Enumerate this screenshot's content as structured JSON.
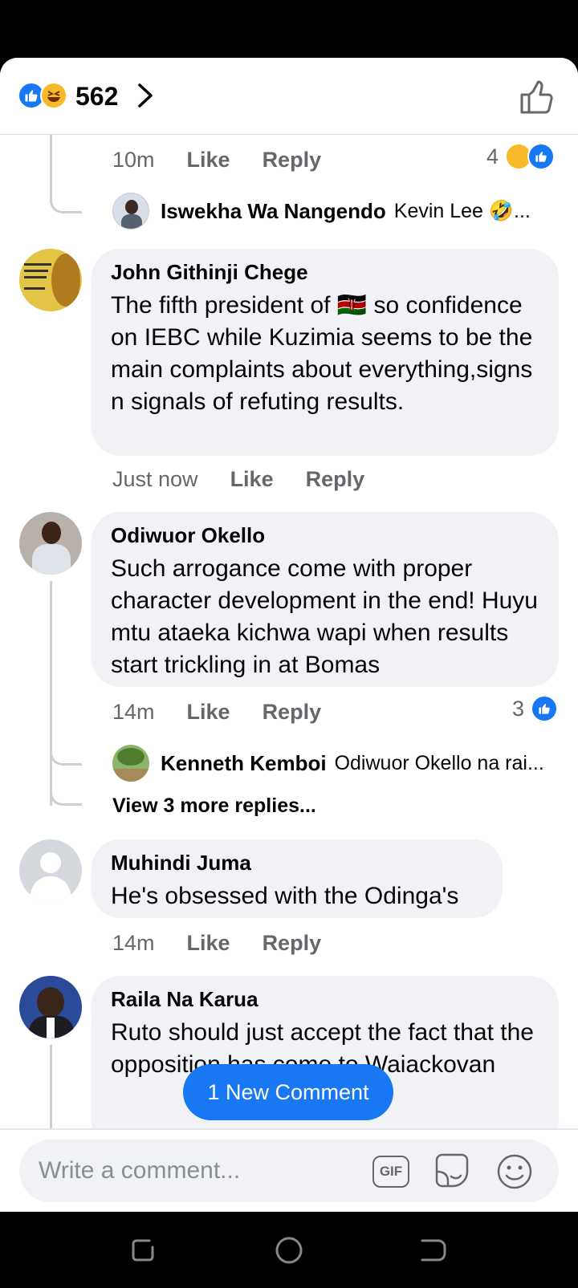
{
  "header": {
    "reaction_count": "562",
    "colors": {
      "like": "#1877f2",
      "haha": "#f7b928"
    }
  },
  "thread0": {
    "time": "10m",
    "like": "Like",
    "reply": "Reply",
    "reaction_count": "4",
    "reply_preview": {
      "name": "Iswekha Wa Nangendo",
      "snippet": "Kevin Lee 🤣..."
    }
  },
  "comments": [
    {
      "author": "John Githinji Chege",
      "text": "The fifth president of 🇰🇪 so confidence on IEBC while Kuzimia seems to be the main complaints about everything,signs n signals of refuting results.",
      "time": "Just now",
      "like": "Like",
      "reply": "Reply"
    },
    {
      "author": "Odiwuor Okello",
      "text": "Such arrogance come with proper character development in the end! Huyu mtu ataeka kichwa wapi when results start trickling in at Bomas",
      "time": "14m",
      "like": "Like",
      "reply": "Reply",
      "reaction_count": "3",
      "reply_preview": {
        "name": "Kenneth Kemboi",
        "snippet": "Odiwuor Okello na rai..."
      },
      "view_more": "View 3 more replies..."
    },
    {
      "author": "Muhindi Juma",
      "text": "He's obsessed with the Odinga's",
      "time": "14m",
      "like": "Like",
      "reply": "Reply"
    },
    {
      "author": "Raila Na Karua",
      "text": "Ruto should just accept the fact that the opposition has come to Waiackovan"
    }
  ],
  "new_comment_pill": "1 New Comment",
  "composer": {
    "placeholder": "Write a comment...",
    "gif_label": "GIF"
  }
}
